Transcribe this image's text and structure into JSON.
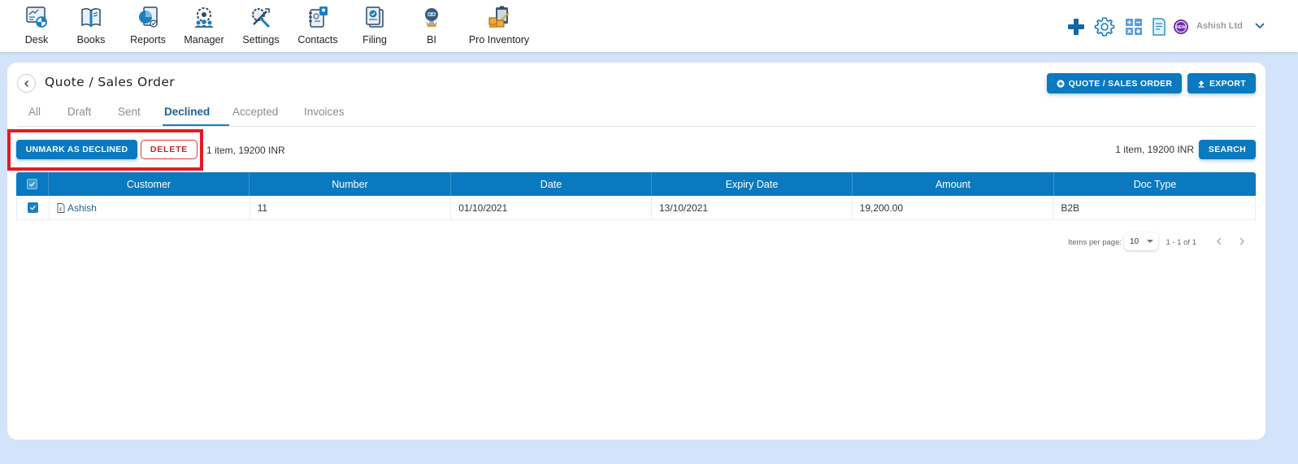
{
  "nav": {
    "items": [
      {
        "label": "Desk",
        "icon": "desk-icon"
      },
      {
        "label": "Books",
        "icon": "books-icon"
      },
      {
        "label": "Reports",
        "icon": "reports-icon"
      },
      {
        "label": "Manager",
        "icon": "manager-icon"
      },
      {
        "label": "Settings",
        "icon": "settings-tools-icon"
      },
      {
        "label": "Contacts",
        "icon": "contacts-icon"
      },
      {
        "label": "Filing",
        "icon": "filing-icon"
      },
      {
        "label": "BI",
        "icon": "bi-robot-icon"
      },
      {
        "label": "Pro Inventory",
        "icon": "pro-inventory-icon"
      }
    ],
    "right": {
      "icons": [
        "plus-icon",
        "gear-icon",
        "calculator-icon",
        "document-icon",
        "new-badge-icon"
      ],
      "company": "Ashish Ltd"
    }
  },
  "page": {
    "title": "Quote / Sales Order",
    "buttons": {
      "new_quote": "QUOTE / SALES ORDER",
      "export": "EXPORT"
    },
    "tabs": [
      {
        "label": "All",
        "active": false
      },
      {
        "label": "Draft",
        "active": false
      },
      {
        "label": "Sent",
        "active": false
      },
      {
        "label": "Declined",
        "active": true
      },
      {
        "label": "Accepted",
        "active": false
      },
      {
        "label": "Invoices",
        "active": false
      }
    ],
    "actions": {
      "unmark": "UNMARK AS DECLINED",
      "delete": "DELETE",
      "selection_summary": "1 item, 19200 INR",
      "total_summary": "1 item, 19200 INR",
      "search": "SEARCH"
    }
  },
  "table": {
    "columns": [
      "Customer",
      "Number",
      "Date",
      "Expiry Date",
      "Amount",
      "Doc Type"
    ],
    "header_checked": true,
    "rows": [
      {
        "checked": true,
        "customer": "Ashish",
        "number": "11",
        "date": "01/10/2021",
        "expiry_date": "13/10/2021",
        "amount": "19,200.00",
        "doc_type": "B2B"
      }
    ]
  },
  "paginator": {
    "items_per_page_label": "Items per page:",
    "items_per_page": "10",
    "range": "1 - 1 of 1"
  },
  "colors": {
    "primary": "#0a79bf",
    "danger": "#c62828",
    "highlight": "#e31b23",
    "background": "#d3e4fa"
  }
}
